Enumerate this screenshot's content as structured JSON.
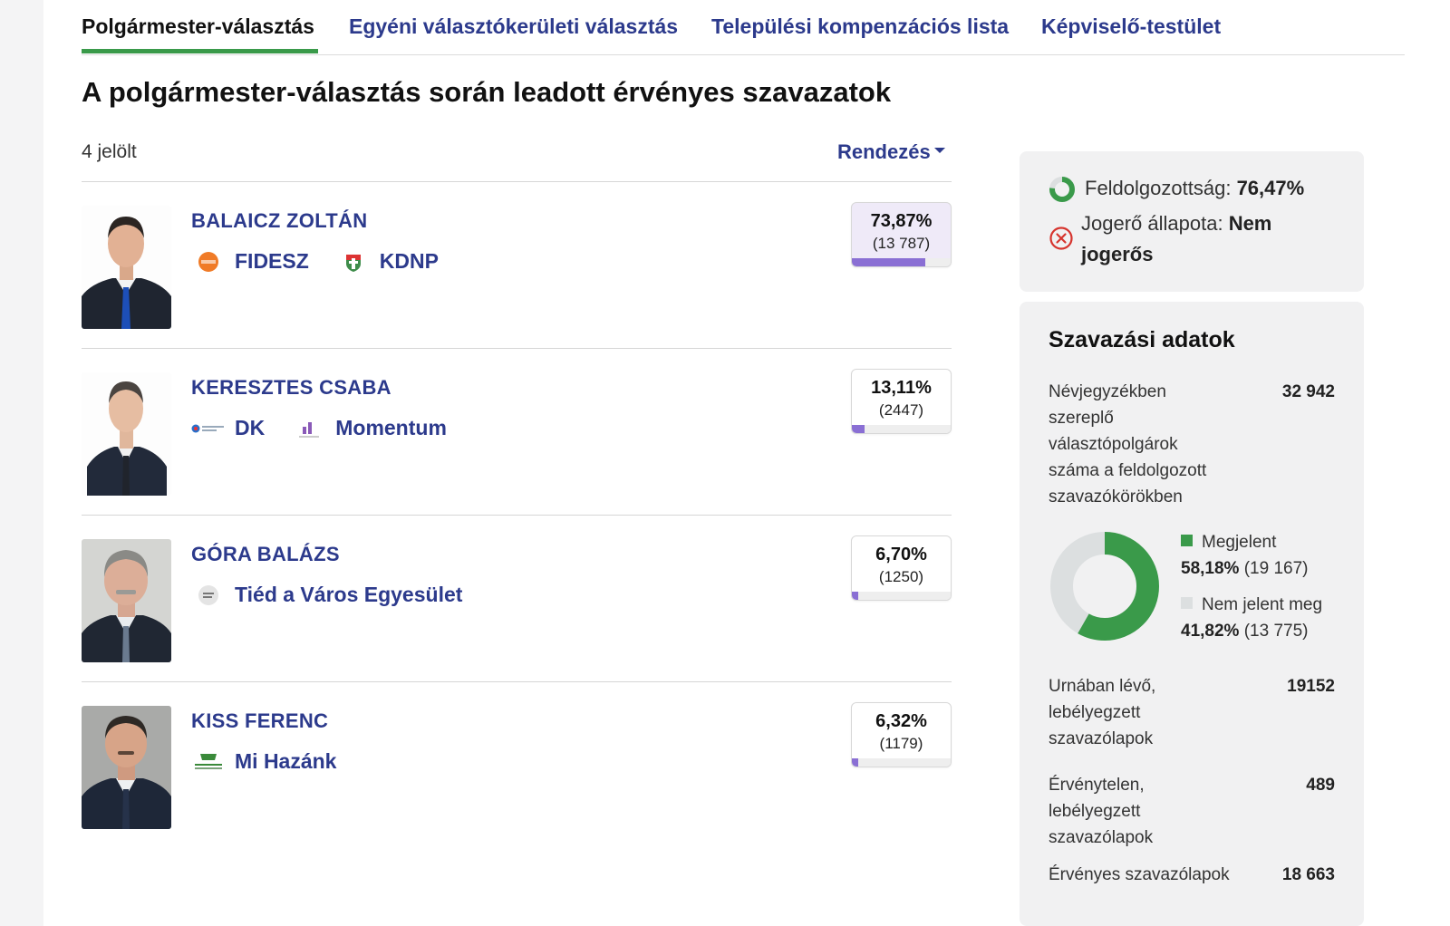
{
  "tabs": [
    {
      "label": "Polgármester-választás",
      "active": true
    },
    {
      "label": "Egyéni választókerületi választás",
      "active": false
    },
    {
      "label": "Települési kompenzációs lista",
      "active": false
    },
    {
      "label": "Képviselő-testület",
      "active": false
    }
  ],
  "heading": "A polgármester-választás során leadott érvényes szavazatok",
  "candidate_count": "4 jelölt",
  "sort_label": "Rendezés",
  "candidates": [
    {
      "name": "BALAICZ ZOLTÁN",
      "parties": [
        {
          "name": "FIDESZ",
          "logo": "fidesz-logo"
        },
        {
          "name": "KDNP",
          "logo": "kdnp-logo"
        }
      ],
      "percent": "73,87%",
      "votes": "(13 787)",
      "share": 0.7387
    },
    {
      "name": "KERESZTES CSABA",
      "parties": [
        {
          "name": "DK",
          "logo": "dk-logo"
        },
        {
          "name": "Momentum",
          "logo": "momentum-logo"
        }
      ],
      "percent": "13,11%",
      "votes": "(2447)",
      "share": 0.1311
    },
    {
      "name": "GÓRA BALÁZS",
      "parties": [
        {
          "name": "Tiéd a Város Egyesület",
          "logo": "tied-a-varos-logo"
        }
      ],
      "percent": "6,70%",
      "votes": "(1250)",
      "share": 0.067
    },
    {
      "name": "KISS FERENC",
      "parties": [
        {
          "name": "Mi Hazánk",
          "logo": "mi-hazank-logo"
        }
      ],
      "percent": "6,32%",
      "votes": "(1179)",
      "share": 0.0632
    }
  ],
  "status": {
    "processed_label": "Feldolgozottság:",
    "processed_value": "76,47%",
    "processed_fraction": 0.7647,
    "legal_label": "Jogerő állapota:",
    "legal_value": "Nem jogerős"
  },
  "stats": {
    "title": "Szavazási adatok",
    "registered_label": "Névjegyzékben szereplő választópolgárok száma a feldolgozott szavazókörökben",
    "registered_value": "32 942",
    "turnout": {
      "appeared_label": "Megjelent",
      "appeared_pct": "58,18%",
      "appeared_count": "(19 167)",
      "appeared_fraction": 0.5818,
      "absent_label": "Nem jelent meg",
      "absent_pct": "41,82%",
      "absent_count": "(13 775)",
      "appeared_color": "#3a9a4a",
      "absent_color": "#dcdfe0"
    },
    "ballots_in_urn_label": "Urnában lévő, lebélyegzett szavazólapok",
    "ballots_in_urn_value": "19152",
    "invalid_label": "Érvénytelen, lebélyegzett szavazólapok",
    "invalid_value": "489",
    "valid_label": "Érvényes szavazólapok",
    "valid_value": "18 663"
  },
  "colors": {
    "accent": "#2c3a8c",
    "bar": "#8a6fd4",
    "green": "#3a9a4a",
    "error": "#d6342e"
  }
}
